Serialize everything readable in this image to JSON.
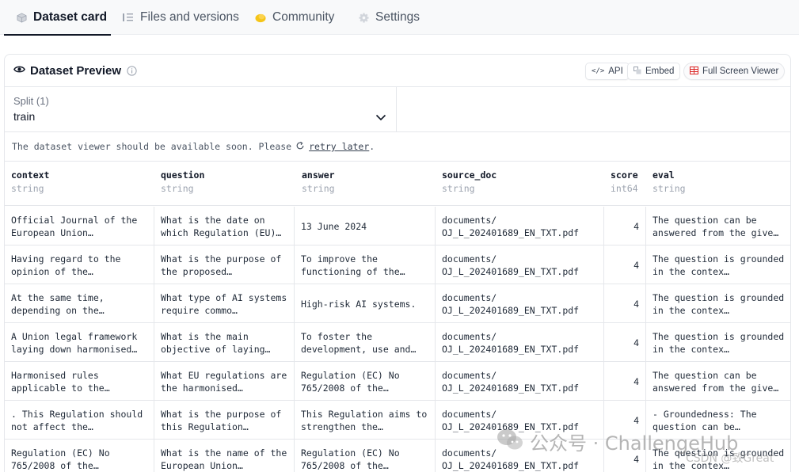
{
  "tabs": [
    {
      "label": "Dataset card",
      "icon": "dataset-cube-icon",
      "active": true
    },
    {
      "label": "Files and versions",
      "icon": "files-icon",
      "active": false
    },
    {
      "label": "Community",
      "icon": "community-icon",
      "active": false
    },
    {
      "label": "Settings",
      "icon": "gear-icon",
      "active": false
    }
  ],
  "preview": {
    "title": "Dataset Preview",
    "api_label": "API",
    "embed_label": "Embed",
    "fullscreen_label": "Full Screen Viewer"
  },
  "split": {
    "label": "Split (1)",
    "value": "train"
  },
  "notice": {
    "text": "The dataset viewer should be available soon. Please",
    "link": "retry later",
    "suffix": "."
  },
  "columns": [
    {
      "name": "context",
      "type": "string"
    },
    {
      "name": "question",
      "type": "string"
    },
    {
      "name": "answer",
      "type": "string"
    },
    {
      "name": "source_doc",
      "type": "string"
    },
    {
      "name": "score",
      "type": "int64"
    },
    {
      "name": "eval",
      "type": "string"
    }
  ],
  "rows": [
    [
      "Official Journal of the European Union…",
      "What is the date on which Regulation (EU)…",
      "13 June 2024",
      "documents/ OJ_L_202401689_EN_TXT.pdf",
      "4",
      "The question can be answered from the give…"
    ],
    [
      "Having regard to the opinion of the…",
      "What is the purpose of the proposed…",
      "To improve the functioning of the…",
      "documents/ OJ_L_202401689_EN_TXT.pdf",
      "4",
      "The question is grounded in the contex…"
    ],
    [
      "At the same time, depending on the…",
      "What type of AI systems require commo…",
      "High-risk AI systems.",
      "documents/ OJ_L_202401689_EN_TXT.pdf",
      "4",
      "The question is grounded in the contex…"
    ],
    [
      "A Union legal framework laying down harmonised…",
      "What is the main objective of laying…",
      "To foster the development, use and…",
      "documents/ OJ_L_202401689_EN_TXT.pdf",
      "4",
      "The question is grounded in the contex…"
    ],
    [
      "Harmonised rules applicable to the…",
      "What EU regulations are the harmonised…",
      "Regulation (EC) No 765/2008 of the…",
      "documents/ OJ_L_202401689_EN_TXT.pdf",
      "4",
      "The question can be answered from the give…"
    ],
    [
      ". This Regulation should not affect the…",
      "What is the purpose of this Regulation…",
      "This Regulation aims to strengthen the…",
      "documents/ OJ_L_202401689_EN_TXT.pdf",
      "4",
      "- Groundedness: The question can be…"
    ],
    [
      "Regulation (EC) No 765/2008 of the…",
      "What is the name of the European Union…",
      "Regulation (EC) No 765/2008 of the…",
      "documents/ OJ_L_202401689_EN_TXT.pdf",
      "4",
      "The question is grounded in the contex…"
    ]
  ],
  "watermark": {
    "main": "公众号 · ChallengeHub",
    "sub": "CSDN @致Great"
  },
  "colors": {
    "accent": "#111827",
    "border": "#e5e7eb",
    "community_icon": "#f5c518",
    "fullscreen_icon": "#dc2626"
  }
}
